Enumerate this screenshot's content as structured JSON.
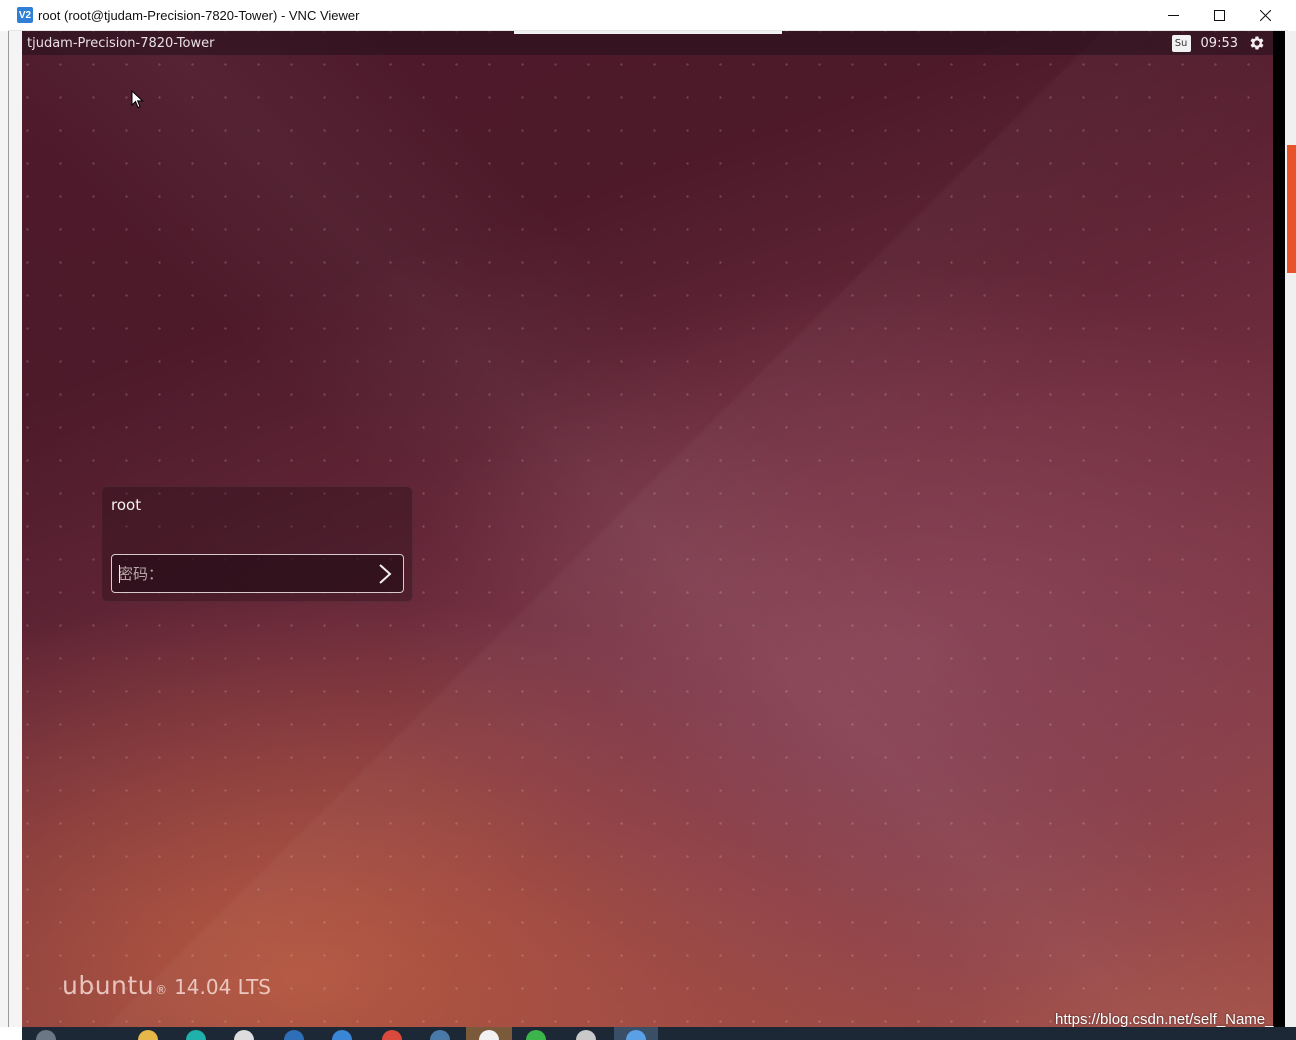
{
  "window": {
    "app_icon_label": "V2",
    "title": "root (root@tjudam-Precision-7820-Tower) - VNC Viewer",
    "controls": [
      "minimize-icon",
      "maximize-icon",
      "close-icon"
    ]
  },
  "panel": {
    "hostname": "tjudam-Precision-7820-Tower",
    "keyboard_indicator": "Su",
    "clock": "09:53",
    "settings_icon": "gear-icon"
  },
  "login": {
    "username": "root",
    "password_placeholder": "密码：",
    "submit_icon": "chevron-right-icon"
  },
  "branding": {
    "logo_text": "ubuntu",
    "registered_mark": "®",
    "version": "14.04 LTS"
  },
  "watermark": "https://blog.csdn.net/self_Name_",
  "colors": {
    "wallpaper_dark": "#4e1a2c",
    "wallpaper_light": "#bc5c44",
    "taskbar": "#1c2835"
  }
}
